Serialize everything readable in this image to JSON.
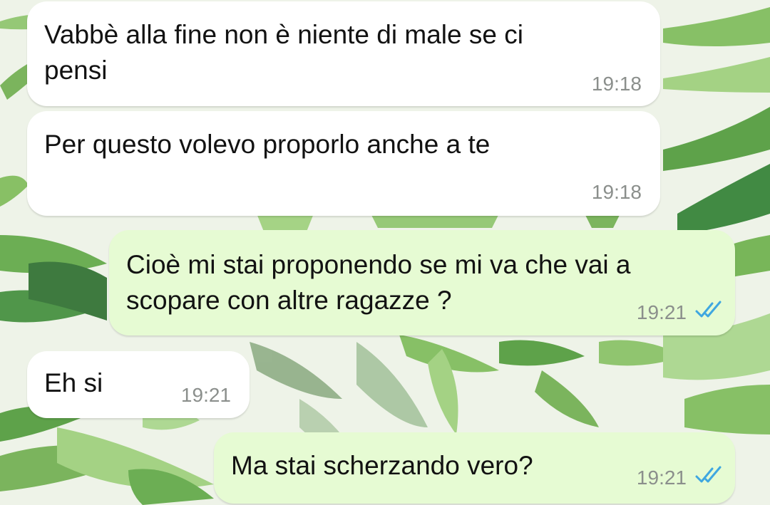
{
  "messages": [
    {
      "direction": "incoming",
      "text": "Vabbè alla fine non è niente di male se ci\npensi",
      "time": "19:18"
    },
    {
      "direction": "incoming",
      "text": "Per questo volevo proporlo anche a te",
      "time": "19:18"
    },
    {
      "direction": "outgoing",
      "text": "Cioè mi stai proponendo se mi va che vai a\nscopare con altre ragazze ?",
      "time": "19:21",
      "status_icon": "double-check-read-icon"
    },
    {
      "direction": "incoming",
      "text": "Eh si",
      "time": "19:21"
    },
    {
      "direction": "outgoing",
      "text": "Ma stai scherzando vero?",
      "time": "19:21",
      "status_icon": "double-check-read-icon"
    }
  ],
  "colors": {
    "incoming_bubble": "#ffffff",
    "outgoing_bubble": "#e6fbd3",
    "read_ticks": "#3fa7e0",
    "timestamp": "#8b8f8c"
  }
}
